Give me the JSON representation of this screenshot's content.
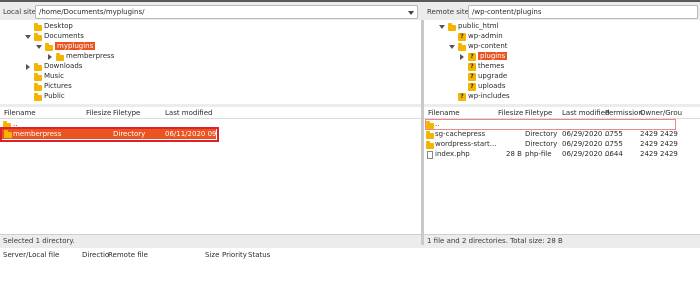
{
  "local": {
    "site_label": "Local site:",
    "path": "/home/Documents/myplugins/",
    "tree": [
      {
        "label": "Desktop",
        "icon": "folder",
        "arrow": "none",
        "level": 2
      },
      {
        "label": "Documents",
        "icon": "folder",
        "arrow": "down",
        "level": 2
      },
      {
        "label": "myplugins",
        "icon": "folder",
        "arrow": "down",
        "level": 3,
        "selected": true
      },
      {
        "label": "memberpress",
        "icon": "folder",
        "arrow": "right",
        "level": 4
      },
      {
        "label": "Downloads",
        "icon": "folder",
        "arrow": "right",
        "level": 2
      },
      {
        "label": "Music",
        "icon": "folder",
        "arrow": "none",
        "level": 2
      },
      {
        "label": "Pictures",
        "icon": "folder",
        "arrow": "none",
        "level": 2
      },
      {
        "label": "Public",
        "icon": "folder",
        "arrow": "none",
        "level": 2
      }
    ],
    "columns": [
      "Filename",
      "Filesize",
      "Filetype",
      "Last modified"
    ],
    "rows": [
      {
        "name": "..",
        "size": "",
        "type": "",
        "modified": ""
      },
      {
        "name": "memberpress",
        "size": "",
        "type": "Directory",
        "modified": "06/11/2020 09:..."
      }
    ],
    "status": "Selected 1 directory."
  },
  "remote": {
    "site_label": "Remote site:",
    "path": "/wp-content/plugins",
    "tree": [
      {
        "label": "public_html",
        "icon": "folder",
        "arrow": "down",
        "level": 1
      },
      {
        "label": "wp-admin",
        "icon": "unknown",
        "arrow": "none",
        "level": 2
      },
      {
        "label": "wp-content",
        "icon": "folder",
        "arrow": "down",
        "level": 2
      },
      {
        "label": "plugins",
        "icon": "unknown",
        "arrow": "right",
        "level": 3,
        "selected": true
      },
      {
        "label": "themes",
        "icon": "unknown",
        "arrow": "none",
        "level": 3
      },
      {
        "label": "upgrade",
        "icon": "unknown",
        "arrow": "none",
        "level": 3
      },
      {
        "label": "uploads",
        "icon": "unknown",
        "arrow": "none",
        "level": 3
      },
      {
        "label": "wp-includes",
        "icon": "unknown",
        "arrow": "none",
        "level": 2
      }
    ],
    "columns": [
      "Filename",
      "Filesize",
      "Filetype",
      "Last modified",
      "Permission",
      "Owner/Grou"
    ],
    "rows": [
      {
        "name": "..",
        "size": "",
        "type": "",
        "modified": "",
        "perm": "",
        "owner": "",
        "icon": "folder"
      },
      {
        "name": "sg-cachepress",
        "size": "",
        "type": "Directory",
        "modified": "06/29/2020 ...",
        "perm": "0755",
        "owner": "2429 2429",
        "icon": "folder"
      },
      {
        "name": "wordpress-start...",
        "size": "",
        "type": "Directory",
        "modified": "06/29/2020 ...",
        "perm": "0755",
        "owner": "2429 2429",
        "icon": "folder"
      },
      {
        "name": "index.php",
        "size": "28 B",
        "type": "php-file",
        "modified": "06/29/2020 ...",
        "perm": "0644",
        "owner": "2429 2429",
        "icon": "file"
      }
    ],
    "status": "1 file and 2 directories. Total size: 28 B"
  },
  "queue": {
    "columns": [
      "Server/Local file",
      "Directio",
      "Remote file",
      "Size",
      "Priority",
      "Status"
    ]
  },
  "colors": {
    "selection": "#e95420",
    "highlight_box": "#e0202a",
    "folder": "#f4b400"
  }
}
